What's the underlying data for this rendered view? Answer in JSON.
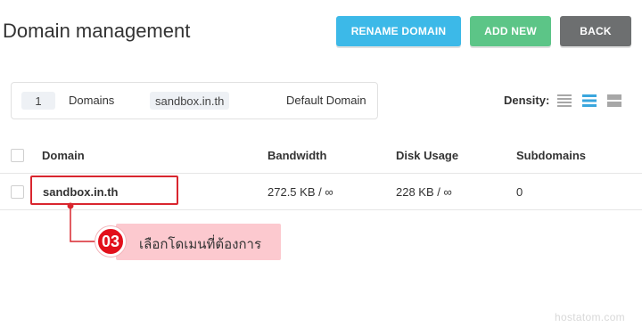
{
  "header": {
    "title": "Domain management",
    "buttons": {
      "rename": "RENAME DOMAIN",
      "add_new": "ADD NEW",
      "back": "BACK"
    }
  },
  "summary": {
    "count": "1",
    "count_label": "Domains",
    "default_domain": "sandbox.in.th",
    "default_label": "Default Domain"
  },
  "density": {
    "label": "Density:",
    "options": [
      "compact-density-icon",
      "normal-density-icon",
      "comfortable-density-icon"
    ],
    "selected": "normal-density-icon"
  },
  "table": {
    "columns": [
      "Domain",
      "Bandwidth",
      "Disk Usage",
      "Subdomains"
    ],
    "rows": [
      {
        "domain": "sandbox.in.th",
        "bandwidth": "272.5 KB / ∞",
        "disk_usage": "228 KB / ∞",
        "subdomains": "0"
      }
    ]
  },
  "annotation": {
    "step": "03",
    "text": "เลือกโดเมนที่ต้องการ"
  },
  "watermark": "hostatom.com",
  "colors": {
    "rename_button": "#3cb9e8",
    "add_button": "#5cc587",
    "back_button": "#6d6f70",
    "density_active": "#3aa6dd",
    "density_inactive": "#a7a7a7",
    "annotation_red": "#e2101b",
    "annotation_bg": "#fcc9cf"
  }
}
